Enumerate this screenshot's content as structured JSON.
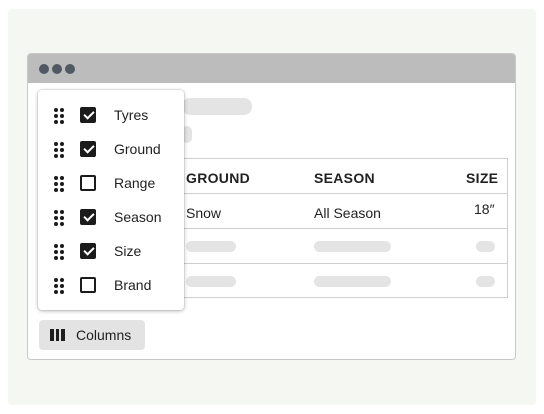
{
  "columns_button": {
    "label": "Columns"
  },
  "table": {
    "headers": [
      "GROUND",
      "SEASON",
      "SIZE"
    ],
    "rows": [
      [
        "Snow",
        "All Season",
        "18″"
      ]
    ]
  },
  "column_menu": {
    "items": [
      {
        "label": "Tyres",
        "checked": true
      },
      {
        "label": "Ground",
        "checked": true
      },
      {
        "label": "Range",
        "checked": false
      },
      {
        "label": "Season",
        "checked": true
      },
      {
        "label": "Size",
        "checked": true
      },
      {
        "label": "Brand",
        "checked": false
      }
    ]
  }
}
